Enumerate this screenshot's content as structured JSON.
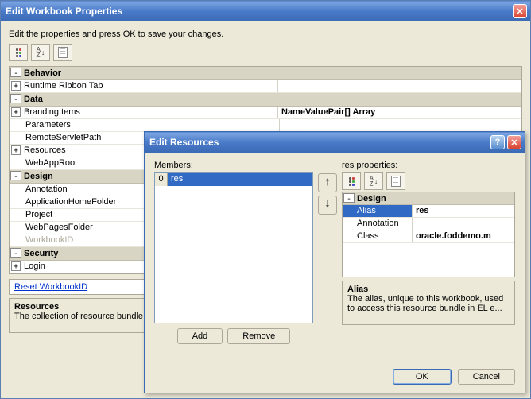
{
  "main": {
    "title": "Edit Workbook Properties",
    "instruction": "Edit the properties and press OK to save your changes.",
    "categories": [
      {
        "label": "Behavior",
        "expanded": true,
        "rows": [
          {
            "name": "Runtime Ribbon Tab",
            "val": "",
            "exp": "+"
          }
        ]
      },
      {
        "label": "Data",
        "expanded": true,
        "rows": [
          {
            "name": "BrandingItems",
            "val": "NameValuePair[] Array",
            "exp": "+",
            "bold": true
          },
          {
            "name": "Parameters",
            "val": ""
          },
          {
            "name": "RemoteServletPath",
            "val": ""
          },
          {
            "name": "Resources",
            "val": "",
            "exp": "+"
          },
          {
            "name": "WebAppRoot",
            "val": ""
          }
        ]
      },
      {
        "label": "Design",
        "expanded": true,
        "rows": [
          {
            "name": "Annotation",
            "val": ""
          },
          {
            "name": "ApplicationHomeFolder",
            "val": ""
          },
          {
            "name": "Project",
            "val": ""
          },
          {
            "name": "WebPagesFolder",
            "val": ""
          },
          {
            "name": "WorkbookID",
            "val": "",
            "disabled": true
          }
        ]
      },
      {
        "label": "Security",
        "expanded": true,
        "rows": [
          {
            "name": "Login",
            "val": "",
            "exp": "+"
          }
        ]
      }
    ],
    "link": "Reset WorkbookID",
    "help_title": "Resources",
    "help_text": "The collection of resource bundle"
  },
  "sub": {
    "title": "Edit Resources",
    "members_label": "Members:",
    "members": [
      {
        "index": "0",
        "name": "res"
      }
    ],
    "add": "Add",
    "remove": "Remove",
    "props_label": "res properties:",
    "cat": "Design",
    "rows": [
      {
        "name": "Alias",
        "val": "res",
        "sel": true
      },
      {
        "name": "Annotation",
        "val": ""
      },
      {
        "name": "Class",
        "val": "oracle.foddemo.m"
      }
    ],
    "help_title": "Alias",
    "help_text": "The alias, unique to this workbook, used to access this resource bundle in EL e...",
    "ok": "OK",
    "cancel": "Cancel"
  }
}
